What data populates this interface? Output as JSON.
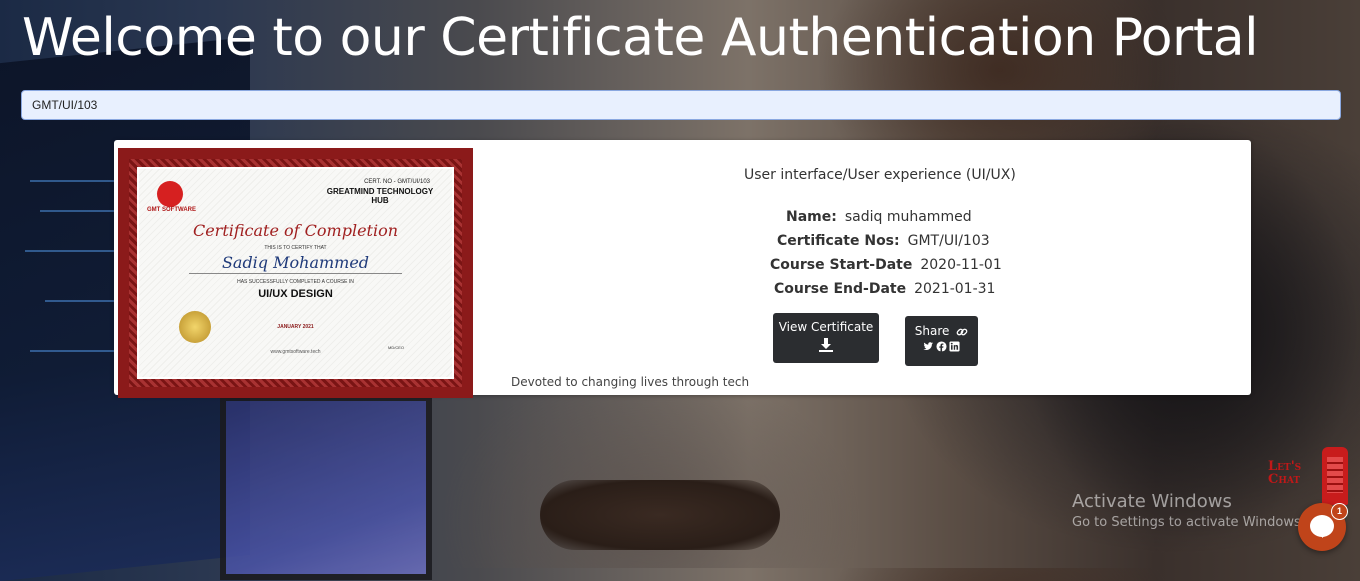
{
  "header": {
    "title": "Welcome to our Certificate Authentication Portal"
  },
  "search": {
    "value": "GMT/UI/103"
  },
  "certificate_image": {
    "cert_no": "CERT. NO - GMT/UI/103",
    "org": "GREATMIND TECHNOLOGY HUB",
    "logo_text": "GMT SOFTWARE",
    "heading": "Certificate of Completion",
    "certify_text": "THIS IS TO CERTIFY THAT",
    "name": "Sadiq Mohammed",
    "completed_text": "HAS SUCCESSFULLY COMPLETED A COURSE IN",
    "course": "UI/UX DESIGN",
    "date": "JANUARY 2021",
    "website": "www.gmtsoftware.tech",
    "signatory": "MD/CEO"
  },
  "details": {
    "course_title": "User interface/User experience (UI/UX)",
    "rows": [
      {
        "label": "Name:",
        "value": "sadiq muhammed"
      },
      {
        "label": "Certificate Nos:",
        "value": "GMT/UI/103"
      },
      {
        "label": "Course Start-Date",
        "value": "2020-11-01"
      },
      {
        "label": "Course End-Date",
        "value": "2021-01-31"
      }
    ]
  },
  "actions": {
    "view_label": "View Certificate",
    "share_label": "Share",
    "icons": [
      "download-icon",
      "link-icon",
      "twitter-icon",
      "facebook-icon",
      "linkedin-icon"
    ]
  },
  "tagline": "Devoted to changing lives through tech",
  "windows_watermark": {
    "title": "Activate Windows",
    "subtitle": "Go to Settings to activate Windows."
  },
  "chat": {
    "label_line1": "Let's",
    "label_line2": "Chat",
    "badge_count": "1",
    "accent_color": "#c0441a"
  }
}
